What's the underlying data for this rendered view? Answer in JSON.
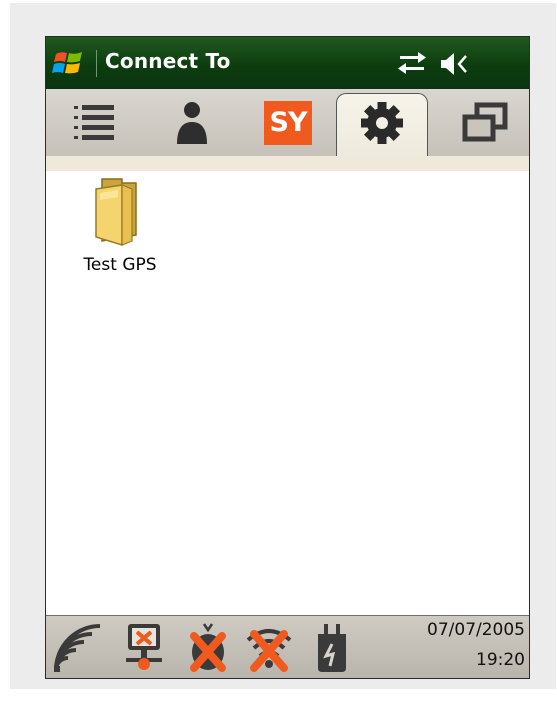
{
  "window": {
    "title": "Connect To"
  },
  "titlebar": {
    "icons": [
      "windows-start-icon",
      "connectivity-icon",
      "volume-icon"
    ]
  },
  "tabs": [
    {
      "icon": "list-icon",
      "active": false
    },
    {
      "icon": "contact-icon",
      "active": false
    },
    {
      "icon": "sy-logo-icon",
      "label": "SY",
      "active": false
    },
    {
      "icon": "gear-icon",
      "active": true
    },
    {
      "icon": "windows-icon",
      "active": false
    }
  ],
  "content": {
    "items": [
      {
        "label": "Test GPS",
        "icon": "folder-icon"
      }
    ]
  },
  "statusbar": {
    "icons": [
      "signal-icon",
      "network-disconnected-icon",
      "gps-off-icon",
      "wifi-off-icon",
      "power-plug-icon"
    ],
    "date": "07/07/2005",
    "time": "19:20"
  },
  "colors": {
    "titlebar": "#0d3d0f",
    "accent_orange": "#f05a1e",
    "tabbar": "#cfcbc4"
  }
}
